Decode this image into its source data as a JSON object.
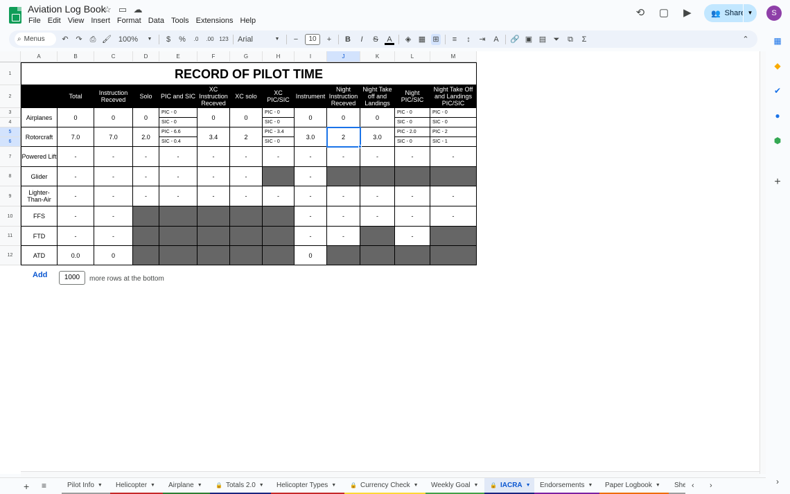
{
  "app": {
    "title": "Aviation Log Book",
    "menus": [
      "File",
      "Edit",
      "View",
      "Insert",
      "Format",
      "Data",
      "Tools",
      "Extensions",
      "Help"
    ],
    "share_label": "Share",
    "avatar_initial": "S"
  },
  "toolbar": {
    "menus_label": "Menus",
    "zoom": "100%",
    "currency": "$",
    "percent": "%",
    "decrease_decimal": ".0",
    "increase_decimal": ".00",
    "number_format": "123",
    "font": "Arial",
    "font_size": "10",
    "bold": "B",
    "italic": "I",
    "strike": "S",
    "text_color": "A"
  },
  "grid": {
    "columns": [
      "A",
      "B",
      "C",
      "D",
      "E",
      "F",
      "G",
      "H",
      "I",
      "J",
      "K",
      "L",
      "M"
    ],
    "selected_column": "J",
    "rows": [
      "1",
      "2",
      "3",
      "4",
      "5",
      "6",
      "7",
      "8",
      "9",
      "10",
      "11",
      "12"
    ],
    "selected_rows": [
      "5",
      "6"
    ],
    "title": "RECORD OF PILOT TIME",
    "headers": [
      "Total",
      "Instruction Receved",
      "Solo",
      "PIC and SIC",
      "XC Instruction Receved",
      "XC solo",
      "XC PIC/SIC",
      "Instrument",
      "Night Instruction Receved",
      "Night Take off and Landings",
      "Night PIC/SIC",
      "Night Take Off and Landings PIC/SIC"
    ],
    "categories": [
      "Airplanes",
      "Rotorcraft",
      "Powered Lift",
      "Glider",
      "Lighter-Than-Air",
      "FFS",
      "FTD",
      "ATD"
    ],
    "airplanes": {
      "b": "0",
      "c": "0",
      "d": "0",
      "e": [
        "PIC - 0",
        "SIC - 0"
      ],
      "f": "0",
      "g": "0",
      "h": [
        "PIC - 0",
        "SIC - 0"
      ],
      "i": "0",
      "j": "0",
      "k": "0",
      "l": [
        "PIC - 0",
        "SIC - 0"
      ],
      "m": [
        "PIC - 0",
        "SIC - 0"
      ]
    },
    "rotorcraft": {
      "b": "7.0",
      "c": "7.0",
      "d": "2.0",
      "e": [
        "PIC - 6.6",
        "SIC - 0.4"
      ],
      "f": "3.4",
      "g": "2",
      "h": [
        "PIC - 3.4",
        "SIC - 0"
      ],
      "i": "3.0",
      "j": "2",
      "k": "3.0",
      "l": [
        "PIC - 2.0",
        "SIC - 0"
      ],
      "m": [
        "PIC - 2",
        "SIC - 1"
      ]
    },
    "dash": "-",
    "ffs_b": "-",
    "atd_b": "0.0",
    "atd_c": "0",
    "atd_i": "0"
  },
  "add_rows": {
    "button": "Add",
    "count": "1000",
    "suffix": "more rows at the bottom"
  },
  "sheets": [
    {
      "name": "Pilot Info",
      "color": "#9e9e9e",
      "locked": false
    },
    {
      "name": "Helicopter",
      "color": "#c62828",
      "locked": false
    },
    {
      "name": "Airplane",
      "color": "#2e7d32",
      "locked": false
    },
    {
      "name": "Totals 2.0",
      "color": "#1a237e",
      "locked": true
    },
    {
      "name": "Helicopter Types",
      "color": "#c62828",
      "locked": false
    },
    {
      "name": "Currency Check",
      "color": "#fdd835",
      "locked": true
    },
    {
      "name": "Weekly Goal",
      "color": "#43a047",
      "locked": false
    },
    {
      "name": "IACRA",
      "color": "#1a237e",
      "locked": true,
      "active": true
    },
    {
      "name": "Endorsements",
      "color": "#7b1fa2",
      "locked": false
    },
    {
      "name": "Paper Logbook",
      "color": "#ef6c00",
      "locked": false
    },
    {
      "name": "She",
      "color": "#9e9e9e",
      "locked": false
    }
  ],
  "colors": {
    "accent": "#1a73e8",
    "header_black": "#000000",
    "blocked_gray": "#666666",
    "share_bg": "#c2e7ff"
  }
}
